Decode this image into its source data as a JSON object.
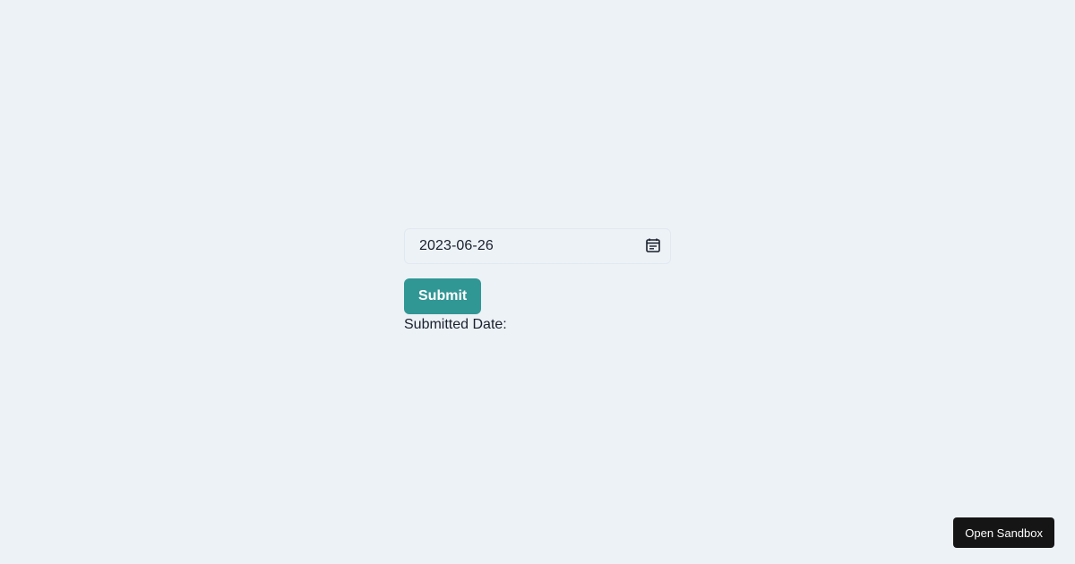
{
  "form": {
    "date_value": "2023-06-26",
    "date_icon": "calendar-icon",
    "submit_label": "Submit",
    "result_label": "Submitted Date:"
  },
  "footer": {
    "sandbox_label": "Open Sandbox"
  },
  "colors": {
    "background": "#edf2f7",
    "accent": "#319795",
    "sandbox_button": "#151515"
  }
}
